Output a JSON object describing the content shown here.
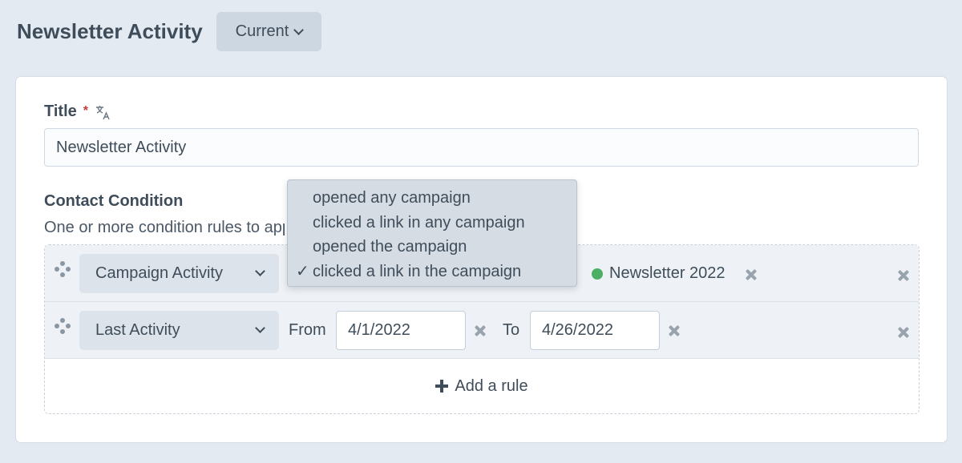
{
  "header": {
    "title": "Newsletter Activity",
    "version_label": "Current"
  },
  "form": {
    "title_label": "Title",
    "required_mark": "*",
    "title_value": "Newsletter Activity",
    "condition_heading": "Contact Condition",
    "condition_description": "One or more condition rules to apply"
  },
  "rules": [
    {
      "field": "Campaign Activity",
      "campaign": "Newsletter 2022"
    },
    {
      "field": "Last Activity",
      "from_label": "From",
      "from_value": "4/1/2022",
      "to_label": "To",
      "to_value": "4/26/2022"
    }
  ],
  "add_rule_label": "Add a rule",
  "dropdown": {
    "options": [
      "opened any campaign",
      "clicked a link in any campaign",
      "opened the campaign",
      "clicked a link in the campaign"
    ],
    "selected_index": 3,
    "check_mark": "✓"
  },
  "colors": {
    "background": "#e4eaf2",
    "status_active": "#4caf64",
    "required": "#c63b3b"
  }
}
